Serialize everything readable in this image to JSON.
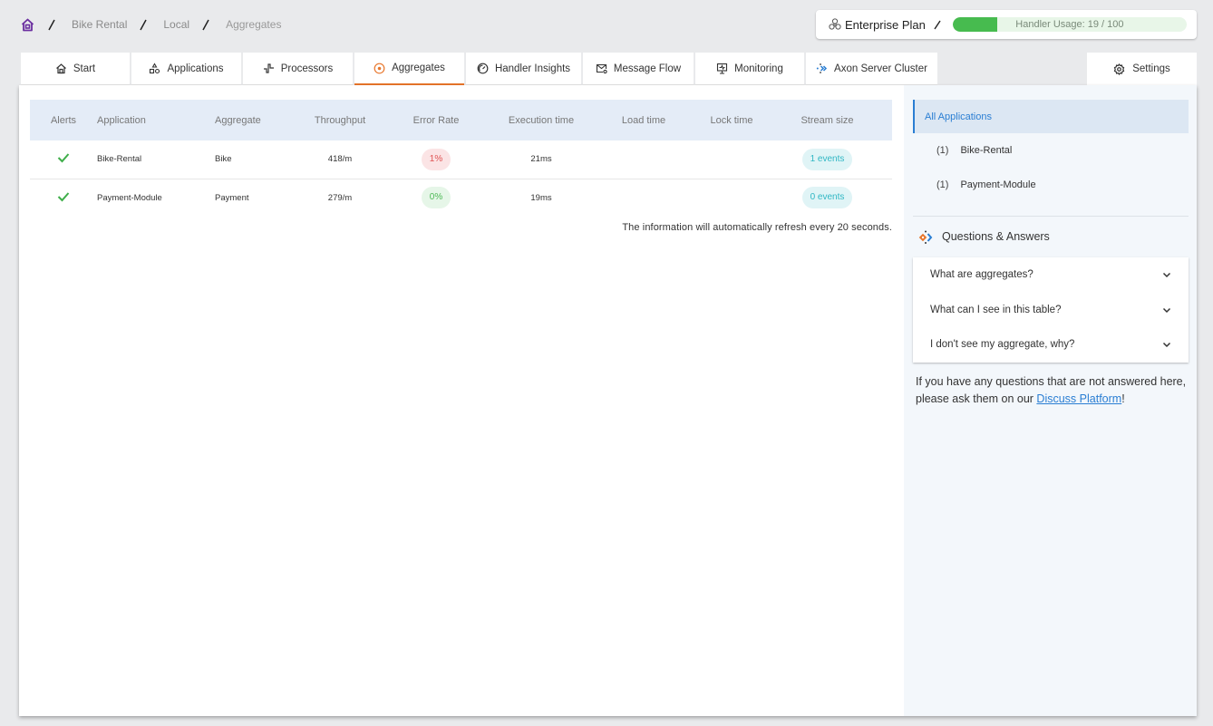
{
  "breadcrumb": {
    "home_icon": "home-icon",
    "items": [
      "Bike Rental",
      "Local",
      "Aggregates"
    ]
  },
  "plan": {
    "icon": "cluster-icon",
    "name": "Enterprise Plan",
    "usage_label": "Handler Usage: 19 / 100",
    "usage_used": 19,
    "usage_total": 100,
    "usage_fraction": 0.19,
    "colors": {
      "fill": "#47bb4f",
      "track": "#e8f6e8"
    }
  },
  "tabs": [
    {
      "label": "Start",
      "icon": "home-icon",
      "active": false
    },
    {
      "label": "Applications",
      "icon": "applications-icon",
      "active": false
    },
    {
      "label": "Processors",
      "icon": "processors-icon",
      "active": false
    },
    {
      "label": "Aggregates",
      "icon": "aggregates-icon",
      "active": true
    },
    {
      "label": "Handler Insights",
      "icon": "gauge-icon",
      "active": false
    },
    {
      "label": "Message Flow",
      "icon": "message-flow-icon",
      "active": false
    },
    {
      "label": "Monitoring",
      "icon": "monitor-icon",
      "active": false
    },
    {
      "label": "Axon Server Cluster",
      "icon": "axon-icon",
      "active": false
    }
  ],
  "settings_tab": {
    "label": "Settings",
    "icon": "gear-icon"
  },
  "accent_color": "#e8762b",
  "table": {
    "columns": [
      "Alerts",
      "Application",
      "Aggregate",
      "Throughput",
      "Error Rate",
      "Execution time",
      "Load time",
      "Lock time",
      "Stream size"
    ],
    "rows": [
      {
        "alert": "ok",
        "application": "Bike-Rental",
        "aggregate": "Bike",
        "throughput": "418/m",
        "error_rate": "1%",
        "error_status": "red",
        "execution_time": "21ms",
        "load_time": "",
        "lock_time": "",
        "stream_size": "1 events"
      },
      {
        "alert": "ok",
        "application": "Payment-Module",
        "aggregate": "Payment",
        "throughput": "279/m",
        "error_rate": "0%",
        "error_status": "green",
        "execution_time": "19ms",
        "load_time": "",
        "lock_time": "",
        "stream_size": "0 events"
      }
    ]
  },
  "refresh_note": "The information will automatically refresh every 20 seconds.",
  "sidebar": {
    "all_label": "All Applications",
    "apps": [
      {
        "count": "(1)",
        "name": "Bike-Rental"
      },
      {
        "count": "(1)",
        "name": "Payment-Module"
      }
    ],
    "qa_title": "Questions & Answers",
    "questions": [
      "What are aggregates?",
      "What can I see in this table?",
      "I don't see my aggregate, why?"
    ],
    "help_text_before": "If you have any questions that are not answered here, please ask them on our ",
    "help_link": "Discuss Platform",
    "help_text_after": "!"
  }
}
